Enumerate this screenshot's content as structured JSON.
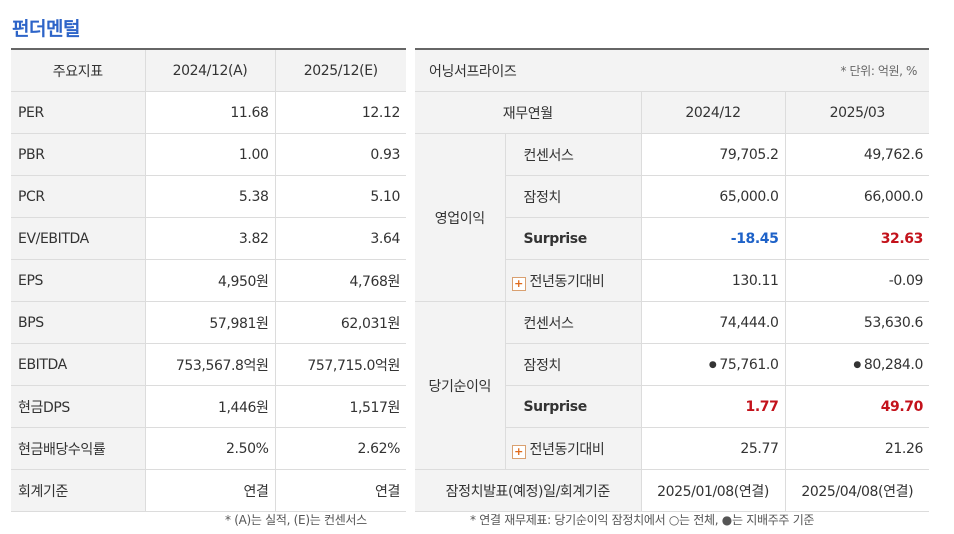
{
  "title": "펀더멘털",
  "indicators": {
    "headers": [
      "주요지표",
      "2024/12(A)",
      "2025/12(E)"
    ],
    "rows": [
      {
        "label": "PER",
        "a": "11.68",
        "e": "12.12"
      },
      {
        "label": "PBR",
        "a": "1.00",
        "e": "0.93"
      },
      {
        "label": "PCR",
        "a": "5.38",
        "e": "5.10"
      },
      {
        "label": "EV/EBITDA",
        "a": "3.82",
        "e": "3.64"
      },
      {
        "label": "EPS",
        "a": "4,950원",
        "e": "4,768원"
      },
      {
        "label": "BPS",
        "a": "57,981원",
        "e": "62,031원"
      },
      {
        "label": "EBITDA",
        "a": "753,567.8억원",
        "e": "757,715.0억원"
      },
      {
        "label": "현금DPS",
        "a": "1,446원",
        "e": "1,517원"
      },
      {
        "label": "현금배당수익률",
        "a": "2.50%",
        "e": "2.62%"
      },
      {
        "label": "회계기준",
        "a": "연결",
        "e": "연결"
      }
    ],
    "note": "* (A)는 실적, (E)는 컨센서스"
  },
  "surprise": {
    "title": "어닝서프라이즈",
    "unit": "* 단위: 억원, %",
    "headers": [
      "재무연월",
      "2024/12",
      "2025/03"
    ],
    "groups": [
      {
        "name": "영업이익",
        "rows": [
          {
            "label": "컨센서스",
            "v1": "79,705.2",
            "v2": "49,762.6"
          },
          {
            "label": "잠정치",
            "v1": "65,000.0",
            "v2": "66,000.0"
          },
          {
            "label": "Surprise",
            "v1": "-18.45",
            "v2": "32.63"
          },
          {
            "label": "전년동기대비",
            "v1": "130.11",
            "v2": "-0.09"
          }
        ]
      },
      {
        "name": "당기순이익",
        "rows": [
          {
            "label": "컨센서스",
            "v1": "74,444.0",
            "v2": "53,630.6"
          },
          {
            "label": "잠정치",
            "v1": "75,761.0",
            "v2": "80,284.0"
          },
          {
            "label": "Surprise",
            "v1": "1.77",
            "v2": "49.70"
          },
          {
            "label": "전년동기대비",
            "v1": "25.77",
            "v2": "21.26"
          }
        ]
      }
    ],
    "footer_row": {
      "label": "잠정치발표(예정)일/회계기준",
      "v1": "2025/01/08(연결)",
      "v2": "2025/04/08(연결)"
    },
    "note": "* 연결 재무제표: 당기순이익 잠정치에서 ○는 전체, ●는 지배주주 기준",
    "colors": {
      "negative": "#1e62c8",
      "positive": "#c3121b",
      "accent": "#2d64c8"
    }
  }
}
